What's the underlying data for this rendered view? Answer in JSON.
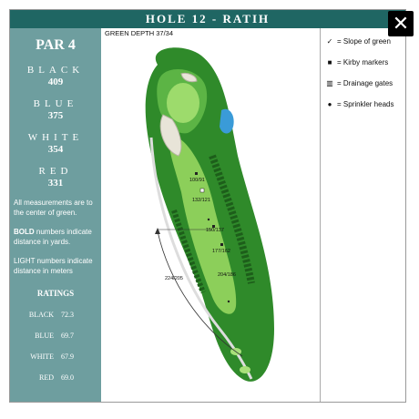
{
  "window": {
    "title": "HOLE 12 - RATIH",
    "close_label": "✕"
  },
  "sidebar": {
    "par": "PAR 4",
    "tees": [
      {
        "name": "BLACK",
        "yards": "409"
      },
      {
        "name": "BLUE",
        "yards": "375"
      },
      {
        "name": "WHITE",
        "yards": "354"
      },
      {
        "name": "RED",
        "yards": "331"
      }
    ],
    "note1": "All measurements are to the center of green.",
    "note2_bold": "BOLD",
    "note2_rest": " numbers indicate distance in yards.",
    "note3": "LIGHT numbers indicate distance in meters",
    "ratings_title": "RATINGS",
    "ratings": [
      {
        "name": "BLACK",
        "value": "72.3"
      },
      {
        "name": "BLUE",
        "value": "69.7"
      },
      {
        "name": "WHITE",
        "value": "67.9"
      },
      {
        "name": "RED",
        "value": "69.0"
      }
    ]
  },
  "map": {
    "green_depth": "GREEN DEPTH 37/34",
    "markers": {
      "m1": "100/91",
      "m2": "132/121",
      "m3": "150/137",
      "m4": "177/162",
      "m5": "204/186",
      "carry": "224/205"
    }
  },
  "legend": [
    {
      "symbol": "✓",
      "label": "= Slope of green",
      "icon": "slope-arrow-icon"
    },
    {
      "symbol": "■",
      "label": "= Kirby markers",
      "icon": "square-icon"
    },
    {
      "symbol": "▥",
      "label": "= Drainage gates",
      "icon": "grate-icon"
    },
    {
      "symbol": "●",
      "label": "= Sprinkler heads",
      "icon": "dot-icon"
    }
  ],
  "colors": {
    "title_bar": "#1f6663",
    "sidebar": "#6e9e9f",
    "rough": "#2f8a2a",
    "fairway": "#8ccf5a",
    "water": "#3a9bd8"
  }
}
